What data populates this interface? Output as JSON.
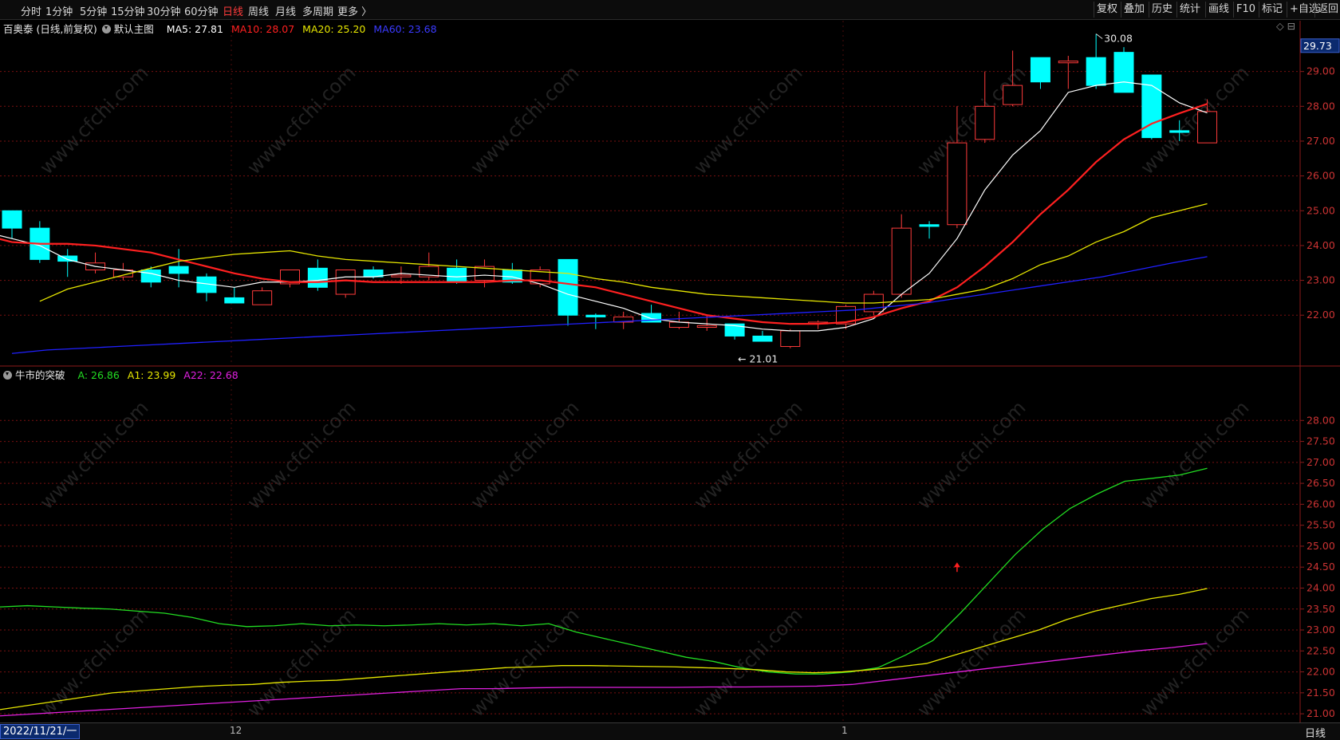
{
  "toolbar": {
    "periods": [
      "分时",
      "1分钟",
      "5分钟",
      "15分钟",
      "30分钟",
      "60分钟",
      "日线",
      "周线",
      "月线",
      "多周期",
      "更多 〉"
    ],
    "active_period": "日线",
    "right_buttons": [
      "复权",
      "叠加",
      "历史",
      "统计",
      "画线",
      "F10",
      "标记",
      "+自选",
      "返回"
    ]
  },
  "main_legend": {
    "stock": "百奥泰 (日线,前复权)",
    "template": "默认主图",
    "ma5": "MA5: 27.81",
    "ma10": "MA10: 28.07",
    "ma20": "MA20: 25.20",
    "ma60": "MA60: 23.68"
  },
  "sub_legend": {
    "name": "牛市的突破",
    "a": "A: 26.86",
    "a1": "A1: 23.99",
    "a22": "A22: 22.68"
  },
  "colors": {
    "up": "#ff3b3b",
    "down": "#00ffff",
    "ma5": "#ffffff",
    "ma10": "#ff2020",
    "ma20": "#e6e600",
    "ma60": "#2020ff",
    "a": "#22dd22",
    "a1": "#e6e600",
    "a22": "#e020e0",
    "grid": "#7a1010"
  },
  "bottom": {
    "date": "2022/11/21/一",
    "month_labels": [
      "12",
      "1"
    ],
    "period": "日线"
  },
  "watermark": "www.cfchi.com",
  "chart_data": [
    {
      "type": "candlestick",
      "price_axis": {
        "ylim": [
          20.7,
          30.0
        ],
        "ticks": [
          22.0,
          23.0,
          24.0,
          25.0,
          26.0,
          27.0,
          28.0,
          29.0
        ],
        "current_price": 29.73
      },
      "annotations": {
        "high": "30.08",
        "low": "21.01"
      },
      "candles": [
        {
          "o": 25.0,
          "h": 25.0,
          "l": 24.2,
          "c": 24.5
        },
        {
          "o": 24.5,
          "h": 24.7,
          "l": 23.5,
          "c": 23.6
        },
        {
          "o": 23.7,
          "h": 23.9,
          "l": 23.1,
          "c": 23.55
        },
        {
          "o": 23.3,
          "h": 23.8,
          "l": 23.2,
          "c": 23.5
        },
        {
          "o": 23.1,
          "h": 23.5,
          "l": 23.0,
          "c": 23.3
        },
        {
          "o": 23.3,
          "h": 23.4,
          "l": 22.8,
          "c": 22.95
        },
        {
          "o": 23.4,
          "h": 23.9,
          "l": 22.8,
          "c": 23.2
        },
        {
          "o": 23.1,
          "h": 23.2,
          "l": 22.4,
          "c": 22.65
        },
        {
          "o": 22.5,
          "h": 22.8,
          "l": 22.4,
          "c": 22.35
        },
        {
          "o": 22.3,
          "h": 22.8,
          "l": 22.3,
          "c": 22.7
        },
        {
          "o": 22.9,
          "h": 23.3,
          "l": 22.8,
          "c": 23.3
        },
        {
          "o": 23.35,
          "h": 23.6,
          "l": 22.7,
          "c": 22.8
        },
        {
          "o": 22.6,
          "h": 23.2,
          "l": 22.5,
          "c": 23.3
        },
        {
          "o": 23.3,
          "h": 23.4,
          "l": 23.05,
          "c": 23.1
        },
        {
          "o": 23.1,
          "h": 23.4,
          "l": 22.9,
          "c": 23.15
        },
        {
          "o": 23.1,
          "h": 23.8,
          "l": 23.0,
          "c": 23.4
        },
        {
          "o": 23.35,
          "h": 23.6,
          "l": 22.9,
          "c": 22.95
        },
        {
          "o": 23.0,
          "h": 23.6,
          "l": 22.8,
          "c": 23.4
        },
        {
          "o": 23.3,
          "h": 23.5,
          "l": 22.9,
          "c": 22.95
        },
        {
          "o": 22.9,
          "h": 23.4,
          "l": 22.8,
          "c": 23.3
        },
        {
          "o": 23.6,
          "h": 23.6,
          "l": 21.7,
          "c": 22.0
        },
        {
          "o": 22.0,
          "h": 22.05,
          "l": 21.6,
          "c": 21.95
        },
        {
          "o": 21.8,
          "h": 22.1,
          "l": 21.6,
          "c": 21.95
        },
        {
          "o": 22.05,
          "h": 22.3,
          "l": 21.8,
          "c": 21.8
        },
        {
          "o": 21.65,
          "h": 22.1,
          "l": 21.6,
          "c": 21.8
        },
        {
          "o": 21.65,
          "h": 22.0,
          "l": 21.55,
          "c": 21.7
        },
        {
          "o": 21.75,
          "h": 21.75,
          "l": 21.3,
          "c": 21.4
        },
        {
          "o": 21.4,
          "h": 21.55,
          "l": 21.25,
          "c": 21.25
        },
        {
          "o": 21.1,
          "h": 21.6,
          "l": 21.05,
          "c": 21.55
        },
        {
          "o": 21.75,
          "h": 21.85,
          "l": 21.6,
          "c": 21.8
        },
        {
          "o": 21.75,
          "h": 22.3,
          "l": 21.6,
          "c": 22.25
        },
        {
          "o": 22.1,
          "h": 22.7,
          "l": 22.0,
          "c": 22.6
        },
        {
          "o": 22.6,
          "h": 24.9,
          "l": 22.5,
          "c": 24.5
        },
        {
          "o": 24.6,
          "h": 24.7,
          "l": 24.2,
          "c": 24.55
        },
        {
          "o": 24.6,
          "h": 28.0,
          "l": 24.5,
          "c": 26.95
        },
        {
          "o": 27.05,
          "h": 29.0,
          "l": 26.95,
          "c": 28.0
        },
        {
          "o": 28.05,
          "h": 29.6,
          "l": 28.0,
          "c": 28.6
        },
        {
          "o": 29.4,
          "h": 29.4,
          "l": 28.5,
          "c": 28.7
        },
        {
          "o": 29.25,
          "h": 29.45,
          "l": 28.5,
          "c": 29.3
        },
        {
          "o": 29.4,
          "h": 30.08,
          "l": 28.5,
          "c": 28.6
        },
        {
          "o": 29.55,
          "h": 29.7,
          "l": 28.4,
          "c": 28.4
        },
        {
          "o": 28.9,
          "h": 28.9,
          "l": 27.05,
          "c": 27.1
        },
        {
          "o": 27.3,
          "h": 27.6,
          "l": 27.0,
          "c": 27.25
        },
        {
          "o": 26.95,
          "h": 28.2,
          "l": 26.95,
          "c": 27.85
        }
      ],
      "series": [
        {
          "name": "MA5",
          "values": [
            24.4,
            24.2,
            24.0,
            23.6,
            23.4,
            23.3,
            23.2,
            23.0,
            22.9,
            22.8,
            22.95,
            22.95,
            23.0,
            23.1,
            23.1,
            23.2,
            23.15,
            23.1,
            23.15,
            23.1,
            22.9,
            22.6,
            22.4,
            22.2,
            21.9,
            21.8,
            21.75,
            21.7,
            21.6,
            21.55,
            21.55,
            21.65,
            21.9,
            22.6,
            23.2,
            24.2,
            25.6,
            26.6,
            27.3,
            28.4,
            28.6,
            28.7,
            28.6,
            28.1,
            27.81
          ]
        },
        {
          "name": "MA10",
          "values": [
            24.3,
            24.1,
            24.05,
            24.05,
            24.0,
            23.9,
            23.8,
            23.6,
            23.4,
            23.2,
            23.05,
            22.95,
            22.95,
            23.0,
            22.95,
            22.95,
            22.95,
            22.95,
            22.95,
            23.0,
            23.0,
            22.9,
            22.8,
            22.6,
            22.4,
            22.2,
            22.0,
            21.9,
            21.8,
            21.75,
            21.75,
            21.8,
            21.95,
            22.2,
            22.4,
            22.8,
            23.4,
            24.1,
            24.9,
            25.6,
            26.4,
            27.05,
            27.5,
            27.8,
            28.07
          ]
        },
        {
          "name": "MA20",
          "values": [
            22.4,
            22.75,
            22.95,
            23.15,
            23.35,
            23.55,
            23.65,
            23.75,
            23.8,
            23.85,
            23.7,
            23.6,
            23.55,
            23.5,
            23.45,
            23.4,
            23.35,
            23.3,
            23.25,
            23.2,
            23.05,
            22.95,
            22.8,
            22.7,
            22.6,
            22.55,
            22.5,
            22.45,
            22.4,
            22.35,
            22.35,
            22.4,
            22.45,
            22.6,
            22.75,
            23.05,
            23.45,
            23.7,
            24.1,
            24.4,
            24.8,
            25.0,
            25.2
          ]
        },
        {
          "name": "MA60",
          "values": [
            20.9,
            21.0,
            21.05,
            21.1,
            21.15,
            21.2,
            21.25,
            21.3,
            21.35,
            21.4,
            21.45,
            21.5,
            21.55,
            21.6,
            21.65,
            21.7,
            21.75,
            21.8,
            21.85,
            21.9,
            21.95,
            22.0,
            22.05,
            22.1,
            22.15,
            22.25,
            22.35,
            22.5,
            22.65,
            22.8,
            22.95,
            23.1,
            23.3,
            23.5,
            23.68
          ]
        }
      ]
    },
    {
      "type": "line",
      "ylim": [
        20.85,
        28.9
      ],
      "ticks": [
        21.0,
        21.5,
        22.0,
        22.5,
        23.0,
        23.5,
        24.0,
        24.5,
        25.0,
        25.5,
        26.0,
        26.5,
        27.0,
        27.5,
        28.0
      ],
      "series": [
        {
          "name": "A",
          "values": [
            23.55,
            23.58,
            23.55,
            23.52,
            23.5,
            23.45,
            23.4,
            23.3,
            23.15,
            23.08,
            23.1,
            23.15,
            23.1,
            23.12,
            23.1,
            23.12,
            23.15,
            23.12,
            23.15,
            23.1,
            23.15,
            22.95,
            22.8,
            22.65,
            22.5,
            22.35,
            22.25,
            22.1,
            22.0,
            21.95,
            21.95,
            22.0,
            22.1,
            22.4,
            22.75,
            23.4,
            24.1,
            24.8,
            25.4,
            25.9,
            26.25,
            26.55,
            26.62,
            26.7,
            26.86
          ]
        },
        {
          "name": "A1",
          "values": [
            21.1,
            21.2,
            21.3,
            21.4,
            21.5,
            21.55,
            21.6,
            21.65,
            21.68,
            21.7,
            21.75,
            21.78,
            21.8,
            21.85,
            21.9,
            21.95,
            22.0,
            22.05,
            22.1,
            22.12,
            22.15,
            22.15,
            22.14,
            22.13,
            22.12,
            22.1,
            22.08,
            22.05,
            22.0,
            21.98,
            22.0,
            22.05,
            22.12,
            22.2,
            22.4,
            22.6,
            22.8,
            23.0,
            23.25,
            23.45,
            23.6,
            23.75,
            23.85,
            23.99
          ]
        },
        {
          "name": "A22",
          "values": [
            20.95,
            21.0,
            21.05,
            21.1,
            21.15,
            21.2,
            21.25,
            21.3,
            21.35,
            21.4,
            21.45,
            21.5,
            21.55,
            21.6,
            21.6,
            21.62,
            21.63,
            21.63,
            21.63,
            21.63,
            21.64,
            21.64,
            21.65,
            21.66,
            21.7,
            21.8,
            21.9,
            22.0,
            22.1,
            22.2,
            22.3,
            22.4,
            22.5,
            22.58,
            22.68
          ]
        }
      ]
    }
  ]
}
